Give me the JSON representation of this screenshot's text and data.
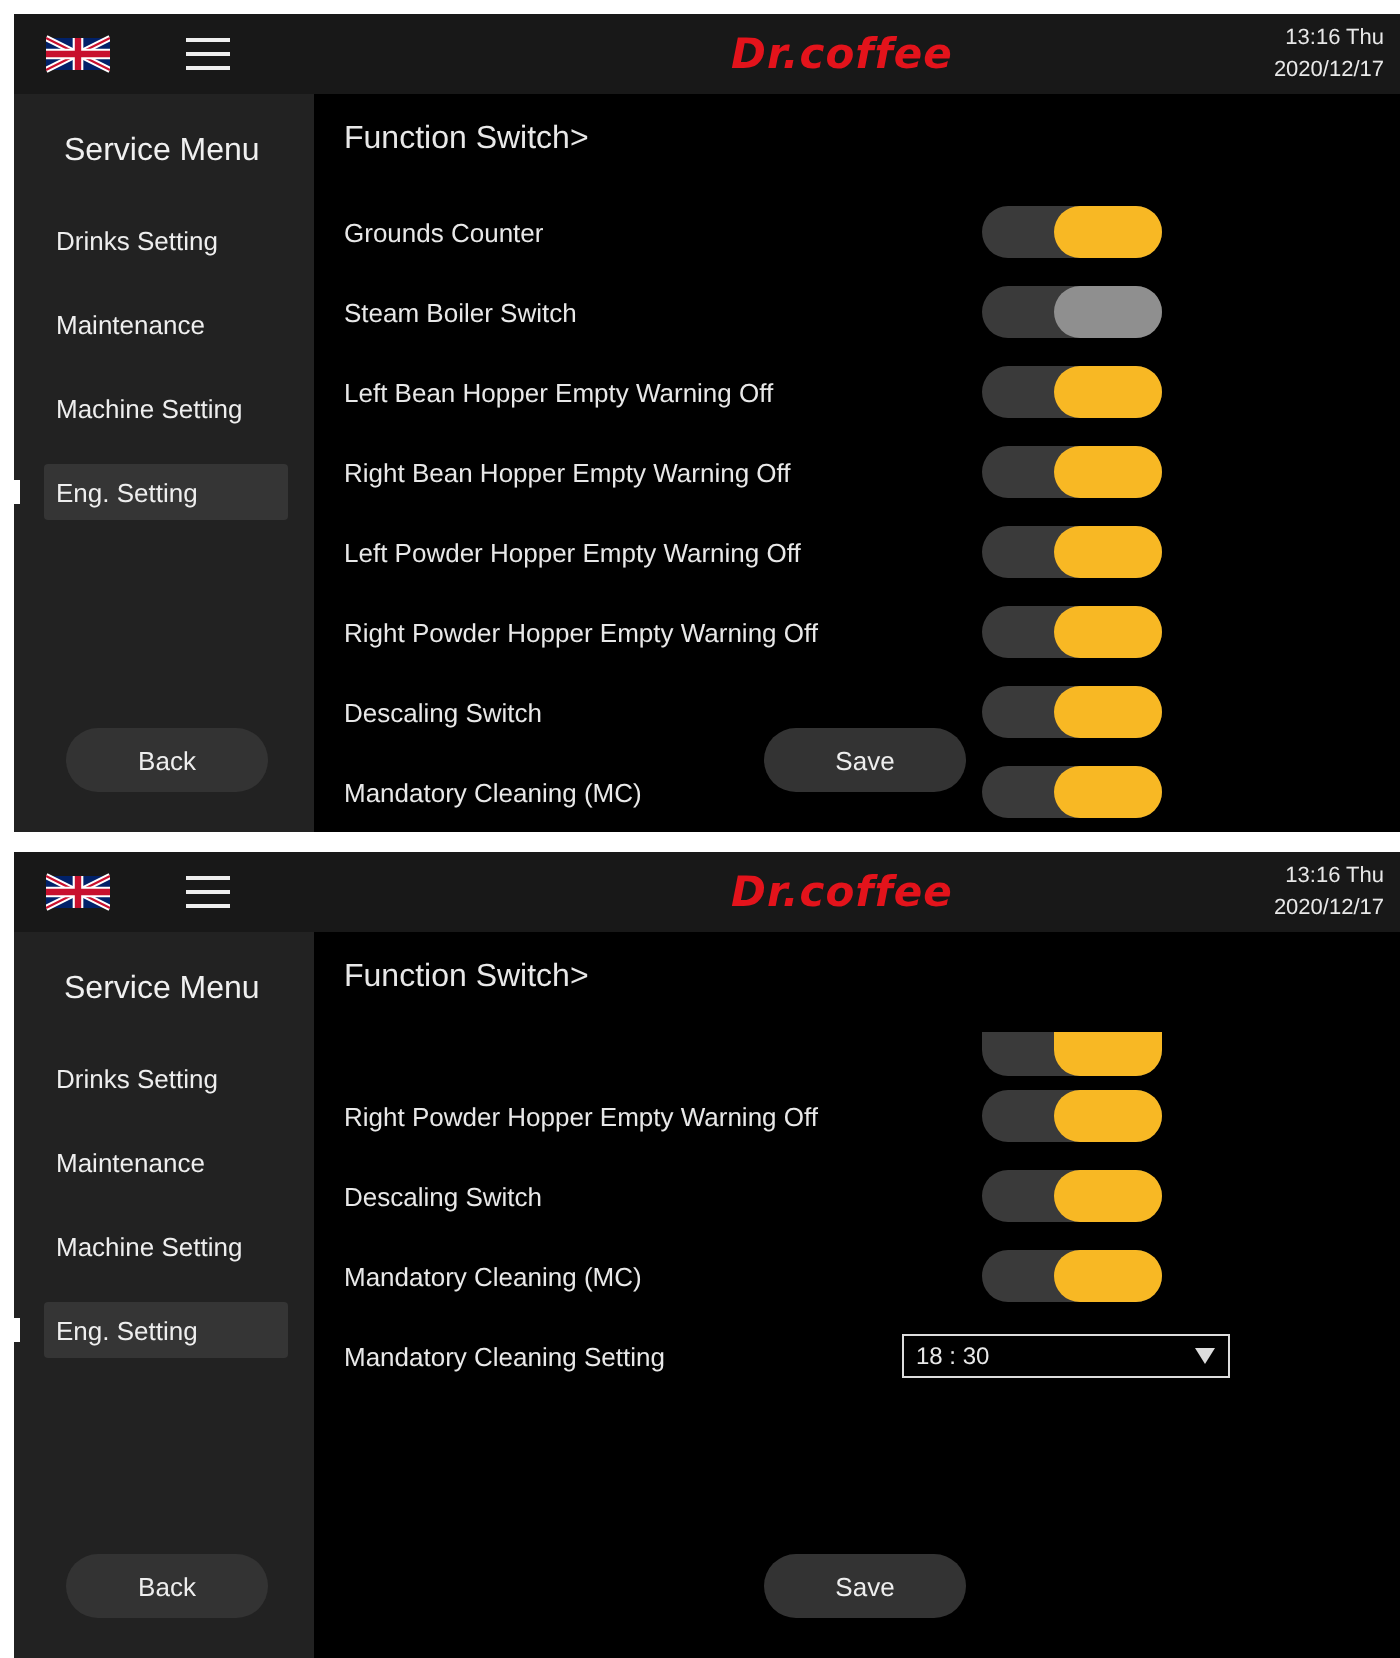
{
  "screens": [
    {
      "header": {
        "logo": "Dr.coffee",
        "time": "13:16 Thu",
        "date": "2020/12/17"
      },
      "sidebar": {
        "title": "Service Menu",
        "items": [
          {
            "label": "Drinks Setting",
            "selected": false
          },
          {
            "label": "Maintenance",
            "selected": false
          },
          {
            "label": "Machine Setting",
            "selected": false
          },
          {
            "label": "Eng. Setting",
            "selected": true
          }
        ],
        "back": "Back"
      },
      "content": {
        "title": "Function Switch>",
        "save": "Save",
        "rows": [
          {
            "kind": "toggle",
            "label": "Grounds Counter",
            "on": true
          },
          {
            "kind": "toggle",
            "label": "Steam Boiler Switch",
            "on": false
          },
          {
            "kind": "toggle",
            "label": "Left Bean Hopper Empty Warning Off",
            "on": true
          },
          {
            "kind": "toggle",
            "label": "Right Bean Hopper Empty Warning Off",
            "on": true
          },
          {
            "kind": "toggle",
            "label": "Left Powder Hopper Empty Warning Off",
            "on": true
          },
          {
            "kind": "toggle",
            "label": "Right Powder Hopper Empty Warning Off",
            "on": true
          },
          {
            "kind": "toggle",
            "label": "Descaling Switch",
            "on": true
          },
          {
            "kind": "toggle",
            "label": "Mandatory Cleaning (MC)",
            "on": true
          }
        ]
      }
    },
    {
      "header": {
        "logo": "Dr.coffee",
        "time": "13:16 Thu",
        "date": "2020/12/17"
      },
      "sidebar": {
        "title": "Service Menu",
        "items": [
          {
            "label": "Drinks Setting",
            "selected": false
          },
          {
            "label": "Maintenance",
            "selected": false
          },
          {
            "label": "Machine Setting",
            "selected": false
          },
          {
            "label": "Eng. Setting",
            "selected": true
          }
        ],
        "back": "Back"
      },
      "content": {
        "title": "Function Switch>",
        "save": "Save",
        "rows": [
          {
            "kind": "partial_toggle",
            "on": true
          },
          {
            "kind": "toggle",
            "label": "Right Powder Hopper Empty Warning Off",
            "on": true
          },
          {
            "kind": "toggle",
            "label": "Descaling Switch",
            "on": true
          },
          {
            "kind": "toggle",
            "label": "Mandatory Cleaning (MC)",
            "on": true
          },
          {
            "kind": "select",
            "label": "Mandatory Cleaning Setting",
            "value": "18 : 30"
          }
        ]
      }
    }
  ]
}
